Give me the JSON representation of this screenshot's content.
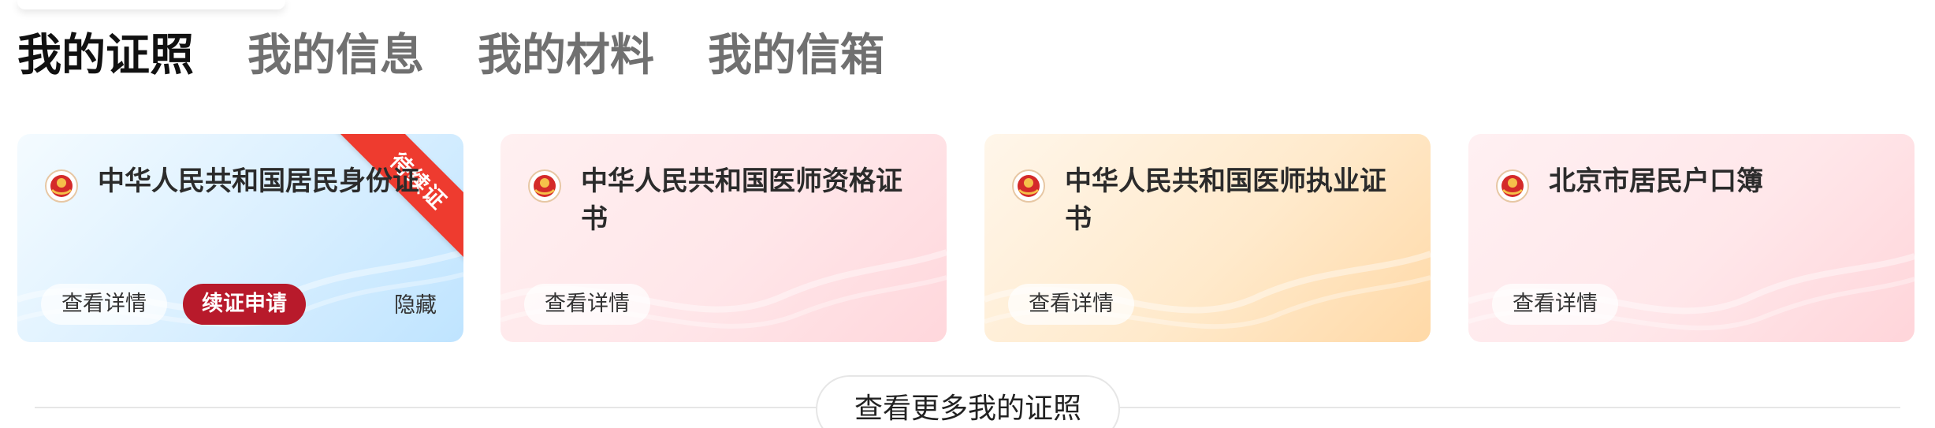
{
  "tabs": [
    {
      "label": "我的证照",
      "active": true
    },
    {
      "label": "我的信息",
      "active": false
    },
    {
      "label": "我的材料",
      "active": false
    },
    {
      "label": "我的信箱",
      "active": false
    }
  ],
  "cards": [
    {
      "theme": "blue",
      "title": "中华人民共和国居民身份证",
      "view_label": "查看详情",
      "renew_label": "续证申请",
      "hide_label": "隐藏",
      "badge": "待续证",
      "badge_color": "#ee3b2f",
      "renew_color": "#b81a2b"
    },
    {
      "theme": "pink",
      "title": "中华人民共和国医师资格证书",
      "view_label": "查看详情"
    },
    {
      "theme": "gold",
      "title": "中华人民共和国医师执业证书",
      "view_label": "查看详情"
    },
    {
      "theme": "pink",
      "title": "北京市居民户口簿",
      "view_label": "查看详情"
    }
  ],
  "more_label": "查看更多我的证照",
  "icons": {
    "emblem": "national-emblem-icon"
  }
}
